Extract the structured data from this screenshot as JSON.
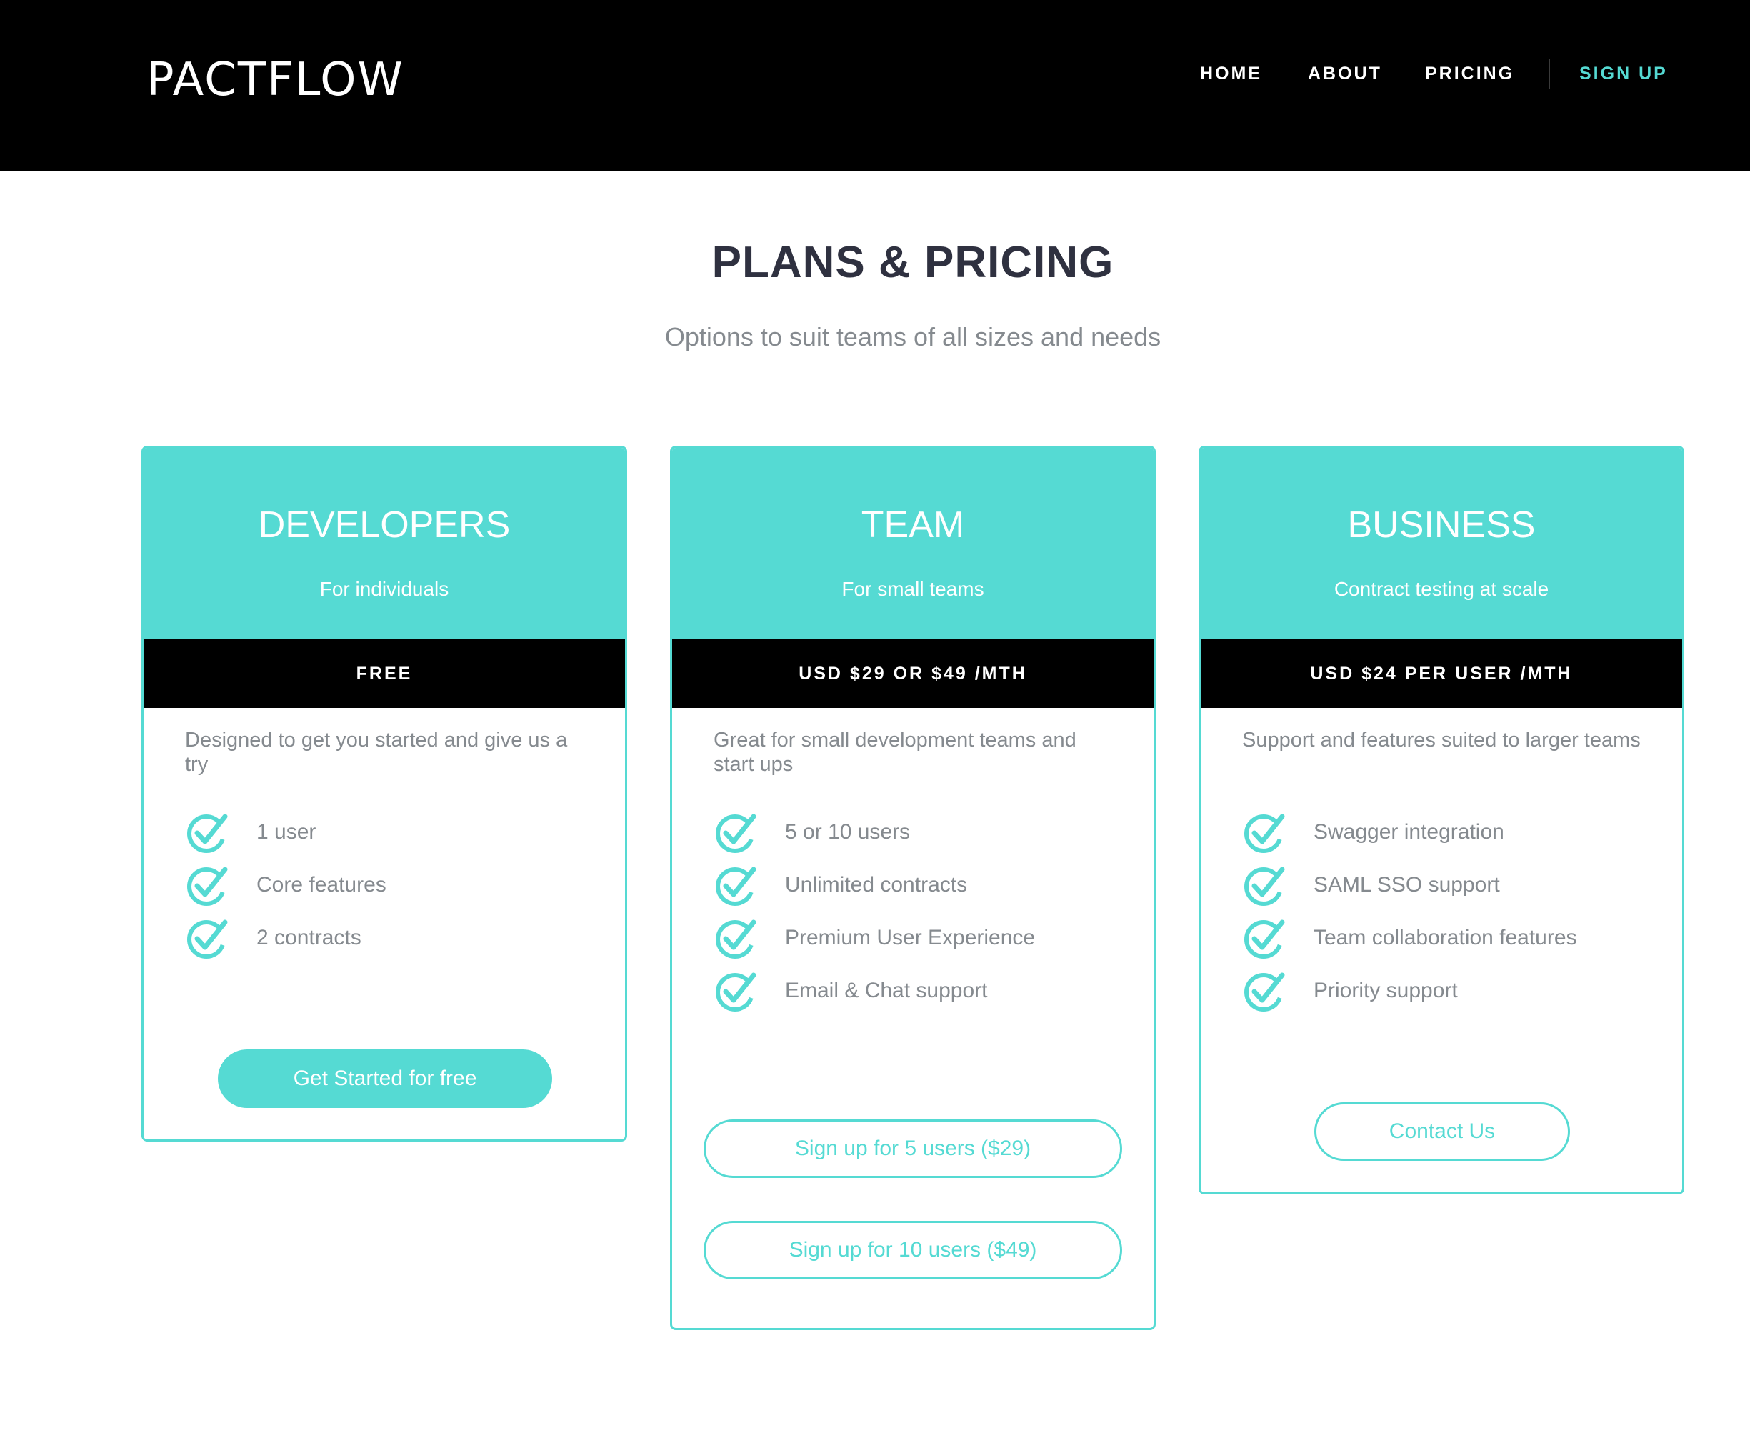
{
  "header": {
    "logo": "PACTFLOW",
    "nav": {
      "home": "HOME",
      "about": "ABOUT",
      "pricing": "PRICING",
      "signup": "SIGN UP"
    }
  },
  "page": {
    "title": "PLANS & PRICING",
    "subtitle": "Options to suit teams of all sizes and needs"
  },
  "plans": [
    {
      "name": "DEVELOPERS",
      "tagline": "For individuals",
      "price": "FREE",
      "description": "Designed to get you started and give us a try",
      "features": [
        "1 user",
        "Core features",
        "2 contracts"
      ],
      "buttons": [
        "Get Started for free"
      ]
    },
    {
      "name": "TEAM",
      "tagline": "For small teams",
      "price": "USD $29 OR $49 /MTH",
      "description": "Great for small development teams and start ups",
      "features": [
        "5 or 10 users",
        "Unlimited contracts",
        "Premium User Experience",
        "Email & Chat support"
      ],
      "buttons": [
        "Sign up for 5 users ($29)",
        "Sign up for 10 users ($49)"
      ]
    },
    {
      "name": "BUSINESS",
      "tagline": "Contract testing at scale",
      "price": "USD $24 PER USER /MTH",
      "description": "Support and features suited to larger teams",
      "features": [
        "Swagger integration",
        "SAML SSO support",
        "Team collaboration features",
        "Priority support"
      ],
      "buttons": [
        "Contact Us"
      ]
    }
  ],
  "colors": {
    "accent": "#55dad3",
    "header_bg": "#000000",
    "title": "#2f3140",
    "muted_text": "#858a8f"
  },
  "icons": {
    "feature_check": "check-circle-icon"
  }
}
